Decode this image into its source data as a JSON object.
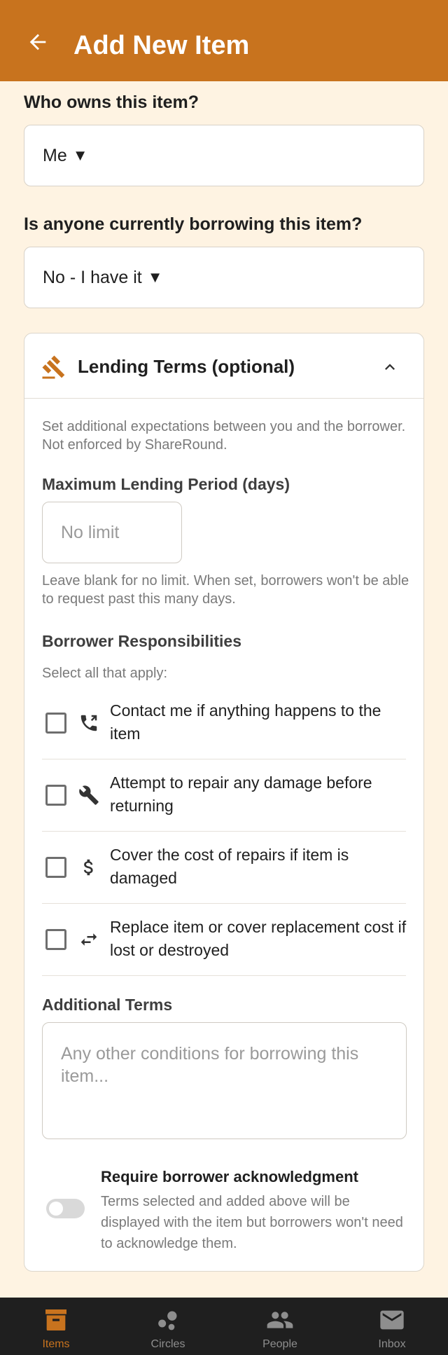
{
  "header": {
    "title": "Add New Item"
  },
  "owner": {
    "label": "Who owns this item?",
    "value": "Me",
    "arrow": "▼"
  },
  "borrowing": {
    "label": "Is anyone currently borrowing this item?",
    "value": "No - I have it",
    "arrow": "▼"
  },
  "lending_terms": {
    "title": "Lending Terms (optional)",
    "description": "Set additional expectations between you and the borrower. Not enforced by ShareRound.",
    "max_period": {
      "label": "Maximum Lending Period (days)",
      "placeholder": "No limit",
      "value": "",
      "hint": "Leave blank for no limit. When set, borrowers won't be able to request past this many days."
    },
    "responsibilities": {
      "label": "Borrower Responsibilities",
      "sublabel": "Select all that apply:",
      "items": [
        {
          "text": "Contact me if anything happens to the item",
          "icon": "phone-icon",
          "checked": false
        },
        {
          "text": "Attempt to repair any damage before returning",
          "icon": "wrench-icon",
          "checked": false
        },
        {
          "text": "Cover the cost of repairs if item is damaged",
          "icon": "dollar-icon",
          "checked": false
        },
        {
          "text": "Replace item or cover replacement cost if lost or destroyed",
          "icon": "swap-icon",
          "checked": false
        }
      ]
    },
    "additional_terms": {
      "label": "Additional Terms",
      "placeholder": "Any other conditions for borrowing this item...",
      "value": ""
    },
    "acknowledgment": {
      "title": "Require borrower acknowledgment",
      "description": "Terms selected and added above will be displayed with the item but borrowers won't need to acknowledge them.",
      "enabled": false
    }
  },
  "nav": {
    "items": [
      {
        "label": "Items",
        "icon": "box-icon",
        "active": true
      },
      {
        "label": "Circles",
        "icon": "circles-icon",
        "active": false
      },
      {
        "label": "People",
        "icon": "people-icon",
        "active": false
      },
      {
        "label": "Inbox",
        "icon": "mail-icon",
        "active": false
      }
    ]
  },
  "colors": {
    "brand": "#C8731E",
    "background": "#FEF3E2",
    "nav_bg": "#1f1f1f"
  }
}
